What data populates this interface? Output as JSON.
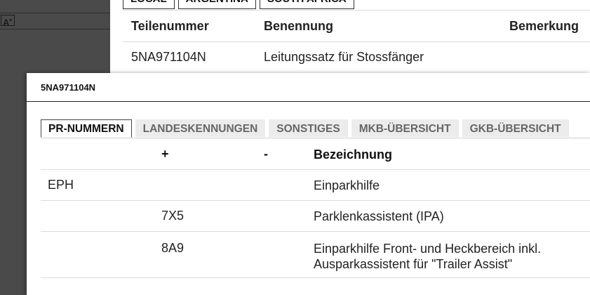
{
  "background": {
    "left_panel": {
      "font_icon_label": "A"
    },
    "tabs": [
      "LOCAL",
      "ARGENTINA",
      "SOUTH AFRICA"
    ],
    "table": {
      "headers": [
        "Teilenummer",
        "Benennung",
        "Bemerkung"
      ],
      "rows": [
        [
          "5NA971104N",
          "Leitungssatz für Stossfänger",
          ""
        ]
      ]
    }
  },
  "dialog": {
    "title": "5NA971104N",
    "tabs": [
      {
        "label": "PR-NUMMERN",
        "active": true
      },
      {
        "label": "LANDESKENNUNGEN",
        "active": false
      },
      {
        "label": "SONSTIGES",
        "active": false
      },
      {
        "label": "MKB-ÜBERSICHT",
        "active": false
      },
      {
        "label": "GKB-ÜBERSICHT",
        "active": false
      }
    ],
    "pr_table": {
      "headers": [
        "",
        "+",
        "-",
        "Bezeichnung"
      ],
      "rows": [
        [
          "EPH",
          "",
          "",
          "Einparkhilfe"
        ],
        [
          "",
          "7X5",
          "",
          "Parklenkassistent (IPA)"
        ],
        [
          "",
          "8A9",
          "",
          "Einparkhilfe Front- und Heckbereich inkl. Ausparkassistent für \"Trailer Assist\""
        ]
      ]
    }
  }
}
